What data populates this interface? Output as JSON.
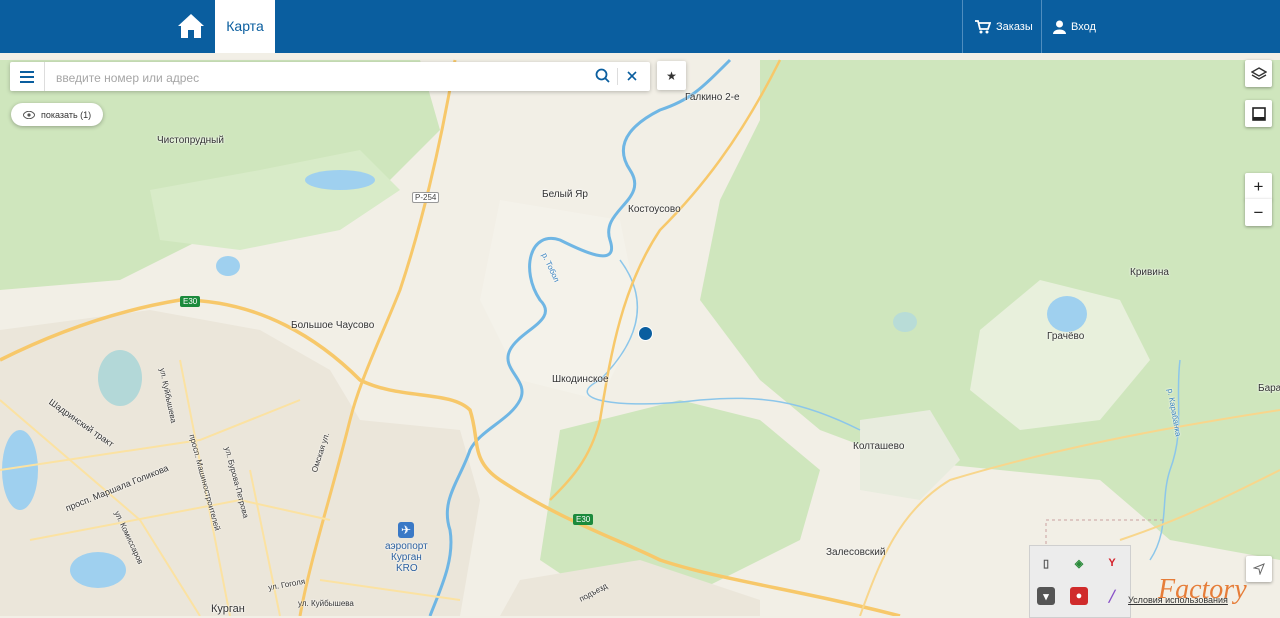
{
  "header": {
    "tab_map": "Карта",
    "orders_label": "Заказы",
    "login_label": "Вход"
  },
  "search": {
    "placeholder": "введите номер или адрес",
    "value": ""
  },
  "show_button_label": "показать (1)",
  "map_labels": {
    "galkino": "Галкино 2-е",
    "chistoprudny": "Чистопрудный",
    "bely_yar": "Белый Яр",
    "kostousovo": "Костоусово",
    "bolshoe_chausovo": "Большое Чаусово",
    "shkodinskoe": "Шкодинское",
    "kolt": "Колташево",
    "krivina": "Кривина",
    "grachevo": "Грачёво",
    "zalesovsky": "Залесовский",
    "bara": "Бара",
    "airport_line1": "аэропорт",
    "airport_line2": "Курган",
    "airport_line3": "KRO",
    "kurgan": "Курган",
    "river_tobol": "р. Тобол",
    "river_karabanka": "р. Карабанка",
    "st_kaibysheva": "ул. Куйбышева",
    "shadrinsky": "Шадринский тракт",
    "st_omskaya": "Омская ул.",
    "st_golikova": "просп. Маршала Голикова",
    "st_mashinostroiteley": "просп. Машиностроителей",
    "st_burova": "ул. Бурова-Петрова",
    "st_komissarov": "ул. Комиссаров",
    "st_gogolya": "ул. Гоголя",
    "st_kuibysheva2": "ул. Куйбышева",
    "podezd": "подъезд",
    "road_r254": "Р-254",
    "road_e30_a": "E30",
    "road_e30_b": "E30",
    "attribution": "Условия использования"
  },
  "watermark": "Factory",
  "colors": {
    "header": "#0a5e9f",
    "marker": "#0a5e9f",
    "forest": "#cfe6bd",
    "water": "#9fd0ef",
    "road": "#f7c86a"
  },
  "icons": {
    "home": "home-icon",
    "cart": "cart-icon",
    "user": "user-icon",
    "menu": "menu-icon",
    "search": "search-icon",
    "clear": "close-icon",
    "star": "star-icon",
    "eye": "eye-icon",
    "layers": "layers-icon",
    "fullscreen": "fullscreen-icon",
    "locate": "locate-arrow-icon"
  }
}
